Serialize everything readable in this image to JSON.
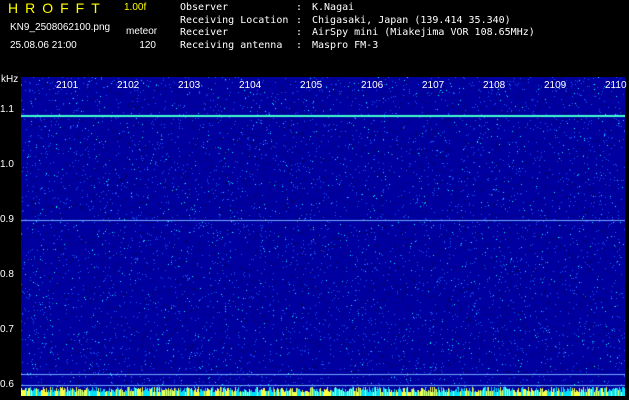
{
  "header": {
    "app_title": "HROFFT",
    "version": "1.00f",
    "filename": "KN9_2508062100.png",
    "param_label": "meteor",
    "param_value": "120",
    "datetime": "25.08.06 21:00"
  },
  "info": [
    {
      "key": "Observer",
      "sep": ":",
      "value": "K.Nagai"
    },
    {
      "key": "Receiving Location",
      "sep": ":",
      "value": "Chigasaki, Japan (139.414 35.340)"
    },
    {
      "key": "Receiver",
      "sep": ":",
      "value": "AirSpy mini (Miakejima VOR 108.65MHz)"
    },
    {
      "key": "Receiving antenna",
      "sep": ":",
      "value": "Maspro FM-3"
    }
  ],
  "spectrogram": {
    "unit_label": "kHz",
    "time_ticks": [
      "2101",
      "2102",
      "2103",
      "2104",
      "2105",
      "2106",
      "2107",
      "2108",
      "2109",
      "2110"
    ],
    "y_ticks": [
      "1.1",
      "1.0",
      "0.9",
      "0.8",
      "0.7",
      "0.6"
    ],
    "y_range_khz": [
      0.58,
      1.16
    ],
    "carrier_line_khz": 1.09,
    "faint_lines_khz": [
      0.9,
      0.62,
      0.6
    ],
    "colors": {
      "background": "#0000a0",
      "dot_low": "#1e5cff",
      "dot_high": "#00ffff",
      "carrier": "#40ffd0",
      "header_accent": "#ffff00"
    }
  }
}
